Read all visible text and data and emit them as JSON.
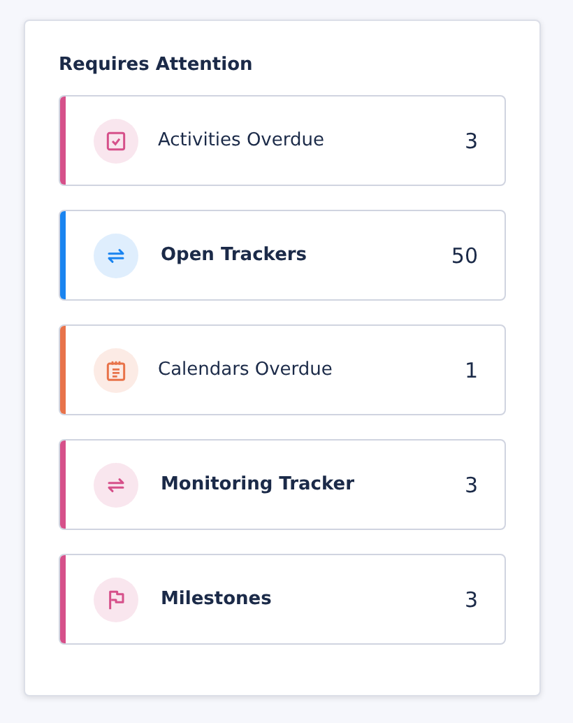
{
  "panel": {
    "title": "Requires Attention",
    "items": [
      {
        "label": "Activities Overdue",
        "count": "3",
        "color": "#d6508a",
        "kind": "check",
        "bold": false
      },
      {
        "label": "Open Trackers",
        "count": "50",
        "color": "#1a84f0",
        "kind": "sync",
        "bold": true
      },
      {
        "label": "Calendars Overdue",
        "count": "1",
        "color": "#e8734a",
        "kind": "notepad",
        "bold": false
      },
      {
        "label": "Monitoring Tracker",
        "count": "3",
        "color": "#d6508a",
        "kind": "sync",
        "bold": true
      },
      {
        "label": "Milestones",
        "count": "3",
        "color": "#d6508a",
        "kind": "flag",
        "bold": true
      }
    ]
  }
}
